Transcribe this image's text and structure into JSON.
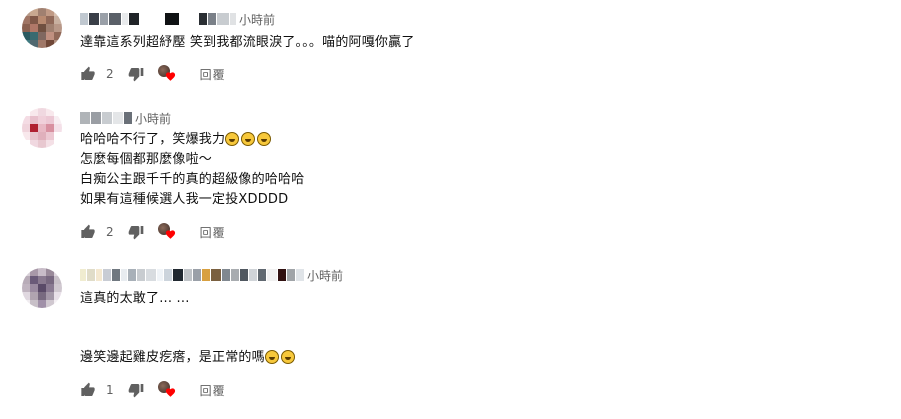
{
  "comments": [
    {
      "time": "小時前",
      "lines": [
        "達靠這系列超紓壓 笑到我都流眼淚了。。。喵的阿嘎你贏了"
      ],
      "likes": "2",
      "reply_label": "回覆"
    },
    {
      "time": "小時前",
      "lines": [
        "哈哈哈不行了，笑爆我力",
        "怎麼每個都那麼像啦～",
        "白痴公主跟千千的真的超級像的哈哈哈",
        "如果有這種候選人我一定投XDDDD"
      ],
      "likes": "2",
      "reply_label": "回覆"
    },
    {
      "time": "小時前",
      "lines": [
        "這真的太敢了... ...",
        "邊笑邊起雞皮疙瘩，是正常的嗎"
      ],
      "likes": "1",
      "reply_label": "回覆"
    }
  ],
  "icons": [
    "like-icon",
    "dislike-icon",
    "heart-icon",
    "rofl-emoji"
  ],
  "colors": {
    "heart": "#ff0000",
    "meta": "#606060",
    "text": "#0f0f0f"
  }
}
